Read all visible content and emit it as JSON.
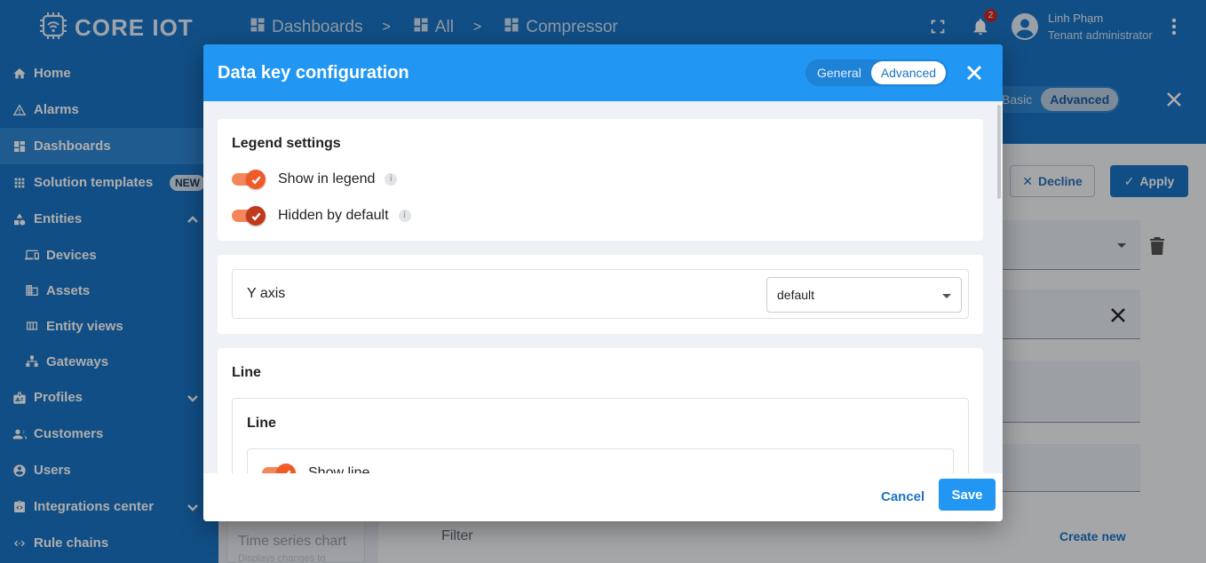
{
  "logo": {
    "text": "CORE IOT"
  },
  "sidebar": {
    "items": [
      {
        "label": "Home",
        "icon": "home-icon"
      },
      {
        "label": "Alarms",
        "icon": "alarm-icon"
      },
      {
        "label": "Dashboards",
        "icon": "dashboard-icon",
        "active": true
      },
      {
        "label": "Solution templates",
        "icon": "apps-icon",
        "badge": "NEW"
      },
      {
        "label": "Entities",
        "icon": "entities-icon",
        "expanded": true
      },
      {
        "label": "Devices",
        "icon": "devices-icon",
        "sub": true
      },
      {
        "label": "Assets",
        "icon": "assets-icon",
        "sub": true
      },
      {
        "label": "Entity views",
        "icon": "entity-views-icon",
        "sub": true
      },
      {
        "label": "Gateways",
        "icon": "gateway-icon",
        "sub": true
      },
      {
        "label": "Profiles",
        "icon": "profiles-icon",
        "expanded": false
      },
      {
        "label": "Customers",
        "icon": "customers-icon"
      },
      {
        "label": "Users",
        "icon": "users-icon"
      },
      {
        "label": "Integrations center",
        "icon": "integrations-icon",
        "expanded": false
      },
      {
        "label": "Rule chains",
        "icon": "rule-chains-icon"
      }
    ]
  },
  "topbar": {
    "breadcrumbs": [
      "Dashboards",
      "All",
      "Compressor"
    ],
    "separator": ">",
    "notification_count": "2",
    "user_name": "Linh Phạm",
    "user_role": "Tenant administrator"
  },
  "background": {
    "toggle": [
      "Basic",
      "Advanced"
    ],
    "decline_label": "Decline",
    "apply_label": "Apply",
    "widget_title": "Time series chart",
    "widget_subtitle": "Displays changes to timeseries",
    "filter_label": "Filter",
    "create_new_label": "Create new"
  },
  "dialog": {
    "title": "Data key configuration",
    "tabs": [
      "General",
      "Advanced"
    ],
    "active_tab": "Advanced",
    "legend": {
      "title": "Legend settings",
      "show_in_legend": {
        "label": "Show in legend",
        "checked": true,
        "info": "i"
      },
      "hidden_by_default": {
        "label": "Hidden by default",
        "checked": true,
        "info": "i"
      }
    },
    "yaxis": {
      "label": "Y axis",
      "value": "default"
    },
    "line_section": {
      "title": "Line",
      "inner_title": "Line",
      "show_line": {
        "label": "Show line",
        "checked": true
      }
    },
    "cancel_label": "Cancel",
    "save_label": "Save"
  },
  "colors": {
    "sidebar": "#1a73c5",
    "dialog_header": "#2196f3",
    "toggle_on": "#f05a28",
    "accent": "#1a73c5"
  }
}
